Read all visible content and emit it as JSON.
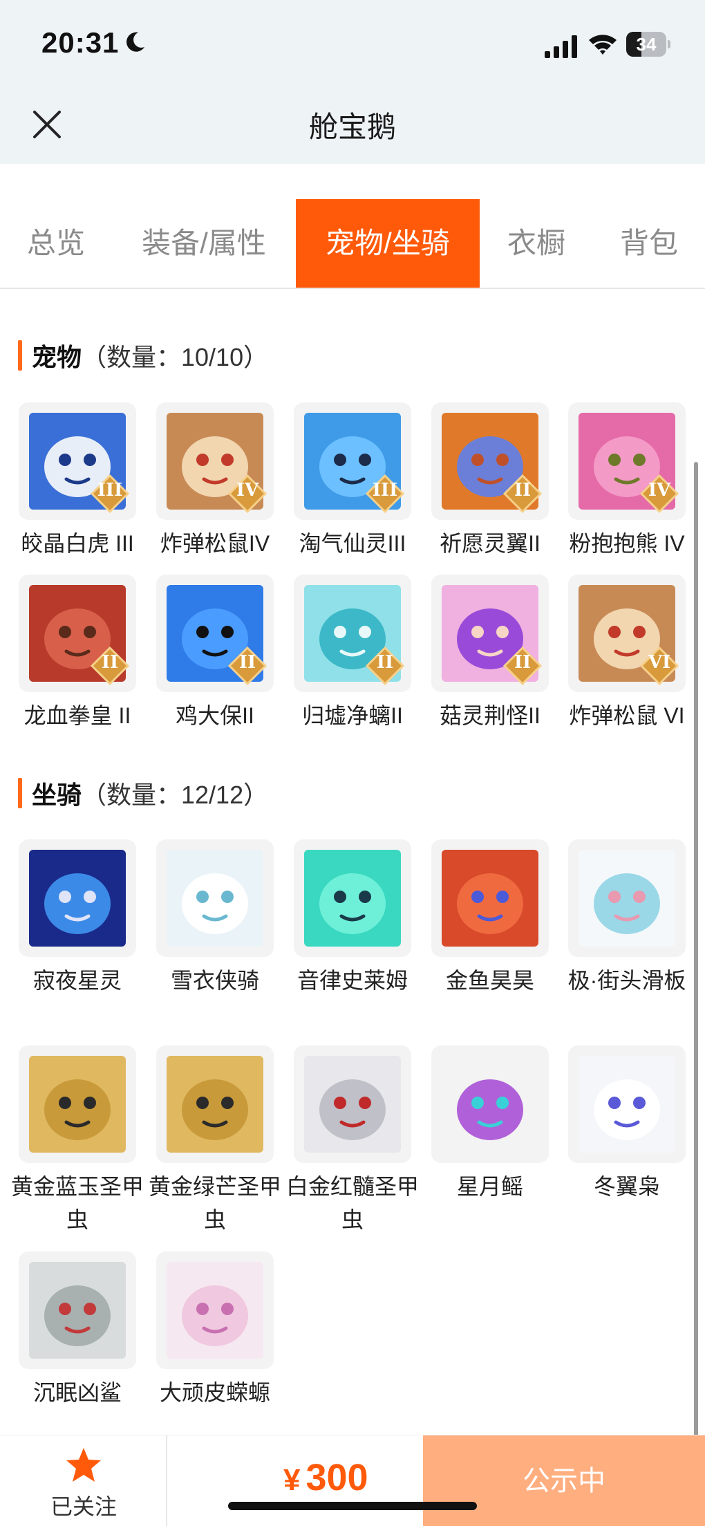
{
  "status_bar": {
    "time": "20:31",
    "battery": "34"
  },
  "header": {
    "title": "舱宝鹅"
  },
  "tabs": [
    {
      "label": "总览",
      "active": false
    },
    {
      "label": "装备/属性",
      "active": false
    },
    {
      "label": "宠物/坐骑",
      "active": true
    },
    {
      "label": "衣橱",
      "active": false
    },
    {
      "label": "背包",
      "active": false
    }
  ],
  "pets": {
    "title": "宠物",
    "count": "（数量：10/10）",
    "items": [
      {
        "name": "皎晶白虎 III",
        "badge": "III",
        "icon": "white-tiger"
      },
      {
        "name": "炸弹松鼠IV",
        "badge": "IV",
        "icon": "bomb-squirrel"
      },
      {
        "name": "淘气仙灵III",
        "badge": "III",
        "icon": "blue-puppy"
      },
      {
        "name": "祈愿灵翼II",
        "badge": "II",
        "icon": "eagle"
      },
      {
        "name": "粉抱抱熊 IV",
        "badge": "IV",
        "icon": "pink-bear"
      },
      {
        "name": "龙血拳皇 II",
        "badge": "II",
        "icon": "red-dragon"
      },
      {
        "name": "鸡大保II",
        "badge": "II",
        "icon": "blue-chicken"
      },
      {
        "name": "归墟净螭II",
        "badge": "II",
        "icon": "cyan-dragon"
      },
      {
        "name": "菇灵荆怪II",
        "badge": "II",
        "icon": "purple-sprite"
      },
      {
        "name": "炸弹松鼠 VI",
        "badge": "VI",
        "icon": "bomb-squirrel"
      }
    ]
  },
  "mounts": {
    "title": "坐骑",
    "count": "（数量：12/12）",
    "items": [
      {
        "name": "寂夜星灵",
        "icon": "night-star-spirit"
      },
      {
        "name": "雪衣侠骑",
        "icon": "white-horse"
      },
      {
        "name": "音律史莱姆",
        "icon": "green-slime"
      },
      {
        "name": "金鱼昊昊",
        "icon": "goldfish"
      },
      {
        "name": "极·街头滑板",
        "icon": "skateboard"
      },
      {
        "name": "黄金蓝玉圣甲虫",
        "icon": "golden-beetle"
      },
      {
        "name": "黄金绿芒圣甲虫",
        "icon": "golden-beetle"
      },
      {
        "name": "白金红髓圣甲虫",
        "icon": "silver-beetle"
      },
      {
        "name": "星月鳐",
        "icon": "manta-ray"
      },
      {
        "name": "冬翼枭",
        "icon": "snow-owl"
      },
      {
        "name": "沉眠凶鲨",
        "icon": "shark"
      },
      {
        "name": "大顽皮蝾螈",
        "icon": "axolotl"
      }
    ]
  },
  "bottom_bar": {
    "follow_label": "已关注",
    "currency": "¥",
    "price": "300",
    "status": "公示中"
  },
  "colors": {
    "accent": "#ff5a0a",
    "status_button": "#ffae80",
    "header_bg": "#eef3f6"
  }
}
